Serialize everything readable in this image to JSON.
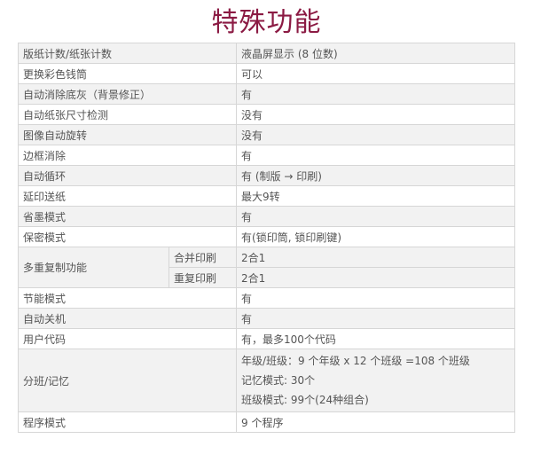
{
  "title": "特殊功能",
  "rows": [
    {
      "feature": "版纸计数/纸张计数",
      "value": "液晶屏显示 (8 位数)"
    },
    {
      "feature": "更换彩色钱筒",
      "value": "可以"
    },
    {
      "feature": "自动消除底灰（背景修正）",
      "value": "有"
    },
    {
      "feature": "自动纸张尺寸检测",
      "value": "没有"
    },
    {
      "feature": "图像自动旋转",
      "value": "没有"
    },
    {
      "feature": "边框消除",
      "value": "有"
    },
    {
      "feature": "自动循环",
      "value": "有 (制版 → 印刷)"
    },
    {
      "feature": "延印送纸",
      "value": "最大9转"
    },
    {
      "feature": "省墨模式",
      "value": "有"
    },
    {
      "feature": "保密模式",
      "value": "有(锁印筒, 锁印刷键)"
    }
  ],
  "multi_copy": {
    "feature": "多重复制功能",
    "subs": [
      {
        "name": "合并印刷",
        "value": "2合1"
      },
      {
        "name": "重复印刷",
        "value": "2合1"
      }
    ]
  },
  "rows2": [
    {
      "feature": "节能模式",
      "value": "有"
    },
    {
      "feature": "自动关机",
      "value": "有"
    },
    {
      "feature": "用户代码",
      "value": "有，最多100个代码"
    }
  ],
  "class_memory": {
    "feature": "分班/记忆",
    "lines": [
      "年级/班级：9 个年级 x 12 个班级 =108 个班级",
      "记忆模式: 30个",
      "班级模式: 99个(24种组合)"
    ]
  },
  "program": {
    "feature": "程序模式",
    "value": "9 个程序"
  }
}
